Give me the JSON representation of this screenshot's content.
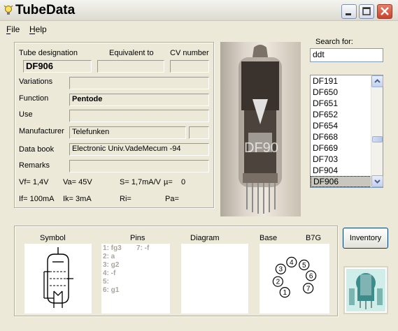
{
  "window": {
    "title": "TubeData"
  },
  "menu": {
    "file": "File",
    "help": "Help"
  },
  "labels": {
    "tube_designation": "Tube designation",
    "equivalent_to": "Equivalent to",
    "cv_number": "CV number",
    "variations": "Variations",
    "function": "Function",
    "use": "Use",
    "manufacturer": "Manufacturer",
    "data_book": "Data book",
    "remarks": "Remarks",
    "search_for": "Search for:"
  },
  "fields": {
    "tube_designation": "DF906",
    "equivalent_to": "",
    "cv_number": "",
    "variations": "",
    "function": "Pentode",
    "use": "",
    "manufacturer": "Telefunken",
    "manufacturer_extra": "",
    "data_book": "Electronic Univ.VadeMecum -94",
    "remarks": "",
    "search": "ddt"
  },
  "params": {
    "vf": "Vf= 1,4V",
    "va": "Va= 45V",
    "s": "S= 1,7mA/V",
    "mu": "µ=",
    "mu_val": "0",
    "if": "If= 100mA",
    "ik": "Ik= 3mA",
    "ri": "Ri=",
    "pa": "Pa="
  },
  "list": {
    "items": [
      "DF191",
      "DF650",
      "DF651",
      "DF652",
      "DF654",
      "DF668",
      "DF669",
      "DF703",
      "DF904",
      "DF906"
    ],
    "selected": "DF906"
  },
  "bottom": {
    "symbol": "Symbol",
    "pins": "Pins",
    "diagram": "Diagram",
    "base": "Base",
    "base_type": "B7G",
    "pins_left": [
      "1: fg3",
      "2: a",
      "3: g2",
      "4: -f",
      "5:",
      "6: g1"
    ],
    "pins_right": [
      "7: -f"
    ],
    "base_pins": [
      "1",
      "2",
      "3",
      "4",
      "5",
      "6",
      "7"
    ]
  },
  "buttons": {
    "inventory": "Inventory"
  },
  "colors": {
    "window_bg": "#ece9d8",
    "close_button": "#c8442a",
    "selection": "#c9c7bd"
  }
}
